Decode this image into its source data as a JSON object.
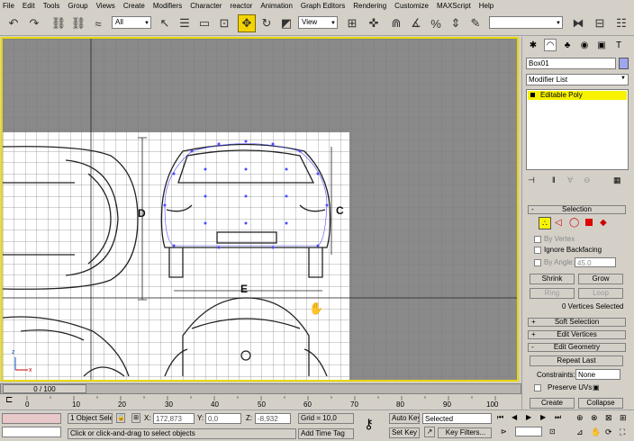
{
  "menu": [
    "File",
    "Edit",
    "Tools",
    "Group",
    "Views",
    "Create",
    "Modifiers",
    "Character",
    "reactor",
    "Animation",
    "Graph Editors",
    "Rendering",
    "Customize",
    "MAXScript",
    "Help"
  ],
  "toolbar": {
    "selection_filter": "All",
    "ref_coord": "View",
    "named_sel": ""
  },
  "viewport": {
    "label": "",
    "blueprint": {
      "label_d": "D",
      "label_c": "C",
      "label_e": "E"
    }
  },
  "command_panel": {
    "object_name": "Box01",
    "modifier_list": "Modifier List",
    "stack_item": "Editable Poly",
    "rollouts": {
      "selection": "Selection",
      "by_vertex": "By Vertex",
      "ignore_backfacing": "Ignore Backfacing",
      "by_angle": "By Angle:",
      "angle_value": "45.0",
      "shrink": "Shrink",
      "grow": "Grow",
      "ring": "Ring",
      "loop": "Loop",
      "vertices_selected": "0 Vertices Selected",
      "soft_selection": "Soft Selection",
      "edit_vertices": "Edit Vertices",
      "edit_geometry": "Edit Geometry",
      "repeat_last": "Repeat Last",
      "constraints_label": "Constraints:",
      "constraints_value": "None",
      "preserve_uvs": "Preserve UVs",
      "create": "Create",
      "collapse": "Collapse"
    }
  },
  "timeline": {
    "frame": "0 / 100",
    "ticks": [
      "0",
      "10",
      "20",
      "30",
      "40",
      "50",
      "60",
      "70",
      "80",
      "90",
      "100"
    ]
  },
  "status": {
    "selection": "1 Object Sele",
    "x_label": "X:",
    "x_value": "172,873",
    "y_label": "Y:",
    "y_value": "0,0",
    "z_label": "Z:",
    "z_value": "-8,932",
    "grid": "Grid = 10,0",
    "prompt": "Click or click-and-drag to select objects",
    "add_time_tag": "Add Time Tag",
    "auto_key": "Auto Key",
    "set_key": "Set Key",
    "key_mode": "Selected",
    "key_filters": "Key Filters..."
  }
}
